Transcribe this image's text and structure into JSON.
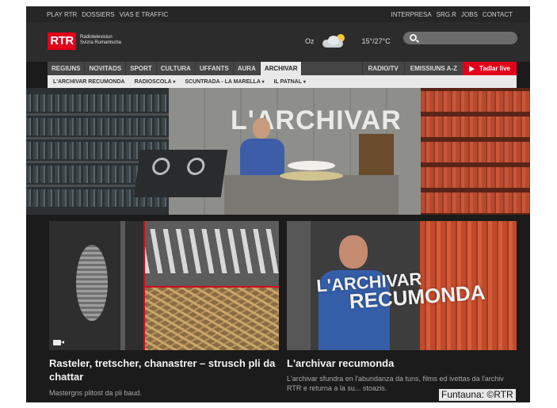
{
  "topbar": {
    "left_links": [
      "PLAY RTR",
      "DOSSIERS",
      "VIAS E TRAFFIC"
    ],
    "right_links": [
      "INTERPRESA",
      "SRG.R",
      "JOBS",
      "CONTACT"
    ]
  },
  "header": {
    "logo": "RTR",
    "logo_sub_1": "Radiotelevisiun",
    "logo_sub_2": "Svizra Rumantscha",
    "weather_place": "Oz",
    "weather_temp": "15°/27°C",
    "search_placeholder": ""
  },
  "nav": {
    "items": [
      "REGIUNS",
      "NOVITADS",
      "SPORT",
      "CULTURA",
      "UFFANTS",
      "AURA",
      "ARCHIVAR"
    ],
    "active": "ARCHIVAR",
    "right_items": [
      "RADIO/TV",
      "EMISSIUNS A-Z"
    ],
    "live_label": "Tadlar live"
  },
  "subnav": {
    "items": [
      "L'ARCHIVAR RECUMONDA",
      "RADIOSCOLA",
      "SCUNTRADA - LA MARELLA",
      "IL PATNAL"
    ]
  },
  "hero": {
    "title": "L'ARCHIVAR"
  },
  "cards": [
    {
      "headline": "Rasteler, tretscher, chanastrer – strusch pli da chattar",
      "description": "Mastergns plitost da pli baud."
    },
    {
      "sign_line1": "L'ARCHIVAR",
      "sign_line2": "RECUMONDA",
      "headline": "L'archivar recumonda",
      "description": "L'archivar sfundra en l'abundanza da tuns, films ed ivettas da l'archiv RTR e returna a la su... stoazis."
    }
  ],
  "credit": "Funtauna: ©RTR",
  "colors": {
    "brand_red": "#e2001a",
    "page_bg": "#1b1b1b"
  }
}
